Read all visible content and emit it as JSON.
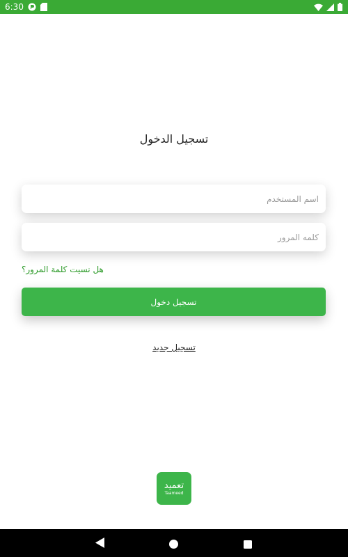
{
  "status_bar": {
    "time": "6:30"
  },
  "login": {
    "title": "تسجيل الدخول",
    "username_placeholder": "اسم المستخدم",
    "password_placeholder": "كلمه المرور",
    "forgot_password": "هل نسيت كلمة المرور؟",
    "login_button": "تسجيل دخول",
    "register_link": "تسجيل جديد"
  },
  "logo": {
    "arabic": "تعميد",
    "latin": "Taameed"
  },
  "colors": {
    "accent": "#3db54a",
    "status_bar": "#3aaa35",
    "link": "#2e9b2a"
  },
  "icons": {
    "status_left": [
      "notification-app-icon",
      "sd-card-icon"
    ],
    "status_right": [
      "wifi-icon",
      "signal-icon",
      "battery-icon"
    ],
    "nav": [
      "back-icon",
      "home-icon",
      "recents-icon"
    ]
  }
}
